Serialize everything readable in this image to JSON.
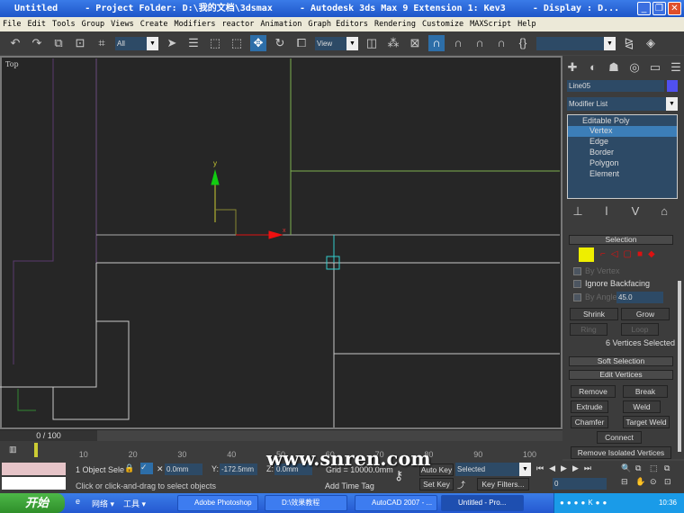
{
  "titlebar": {
    "title": "Untitled     - Project Folder: D:\\我的文档\\3dsmax     - Autodesk 3ds Max 9 Extension 1: Kev3     - Display : D...",
    "min": "_",
    "max": "❐",
    "close": "✕"
  },
  "menu": [
    "File",
    "Edit",
    "Tools",
    "Group",
    "Views",
    "Create",
    "Modifiers",
    "reactor",
    "Animation",
    "Graph Editors",
    "Rendering",
    "Customize",
    "MAXScript",
    "Help"
  ],
  "toolbar": {
    "selection_filter": "All",
    "ref_coord": "View",
    "named_selection": ""
  },
  "viewport": {
    "label": "Top",
    "gizmo_y": "y",
    "gizmo_x": "x"
  },
  "panel": {
    "object_name": "Line05",
    "object_color": "#5050f0",
    "modifier_list": "Modifier List",
    "stack": [
      {
        "label": "Editable Poly"
      },
      {
        "label": "Vertex",
        "selected": true
      },
      {
        "label": "Edge"
      },
      {
        "label": "Border"
      },
      {
        "label": "Polygon"
      },
      {
        "label": "Element"
      }
    ],
    "selection": {
      "title": "Selection",
      "by_vertex": "By Vertex",
      "ignore_backfacing": "Ignore Backfacing",
      "by_angle": "By Angle",
      "angle": "45.0",
      "shrink": "Shrink",
      "grow": "Grow",
      "ring": "Ring",
      "loop": "Loop",
      "status": "6 Vertices Selected"
    },
    "soft_selection": "Soft Selection",
    "edit_vertices": {
      "title": "Edit Vertices",
      "remove": "Remove",
      "break": "Break",
      "extrude": "Extrude",
      "weld": "Weld",
      "chamfer": "Chamfer",
      "target_weld": "Target Weld",
      "connect": "Connect",
      "remove_isolated": "Remove Isolated Vertices"
    }
  },
  "timeline": {
    "frame": "0 / 100",
    "ticks": [
      "0",
      "10",
      "20",
      "30",
      "40",
      "50",
      "60",
      "70",
      "80",
      "90",
      "100"
    ]
  },
  "status": {
    "selected": "1 Object Sele",
    "x": "0.0mm",
    "y": "-172.5mm",
    "z": "0.0mm",
    "grid": "Grid = 10000.0mm",
    "prompt": "Click or click-and-drag to select objects",
    "add_time_tag": "Add Time Tag",
    "auto_key": "Auto Key",
    "set_key": "Set Key",
    "key_mode": "Selected",
    "key_filters": "Key Filters...",
    "current_frame": "0"
  },
  "watermark": "www.snren.com",
  "taskbar": {
    "start": "开始",
    "quick": [
      "网络 ▾",
      "工具 ▾"
    ],
    "tasks": [
      "Adobe Photoshop",
      "D:\\效果教程",
      "AutoCAD 2007 - ...",
      "Untitled    - Pro..."
    ],
    "clock": "10:36"
  }
}
